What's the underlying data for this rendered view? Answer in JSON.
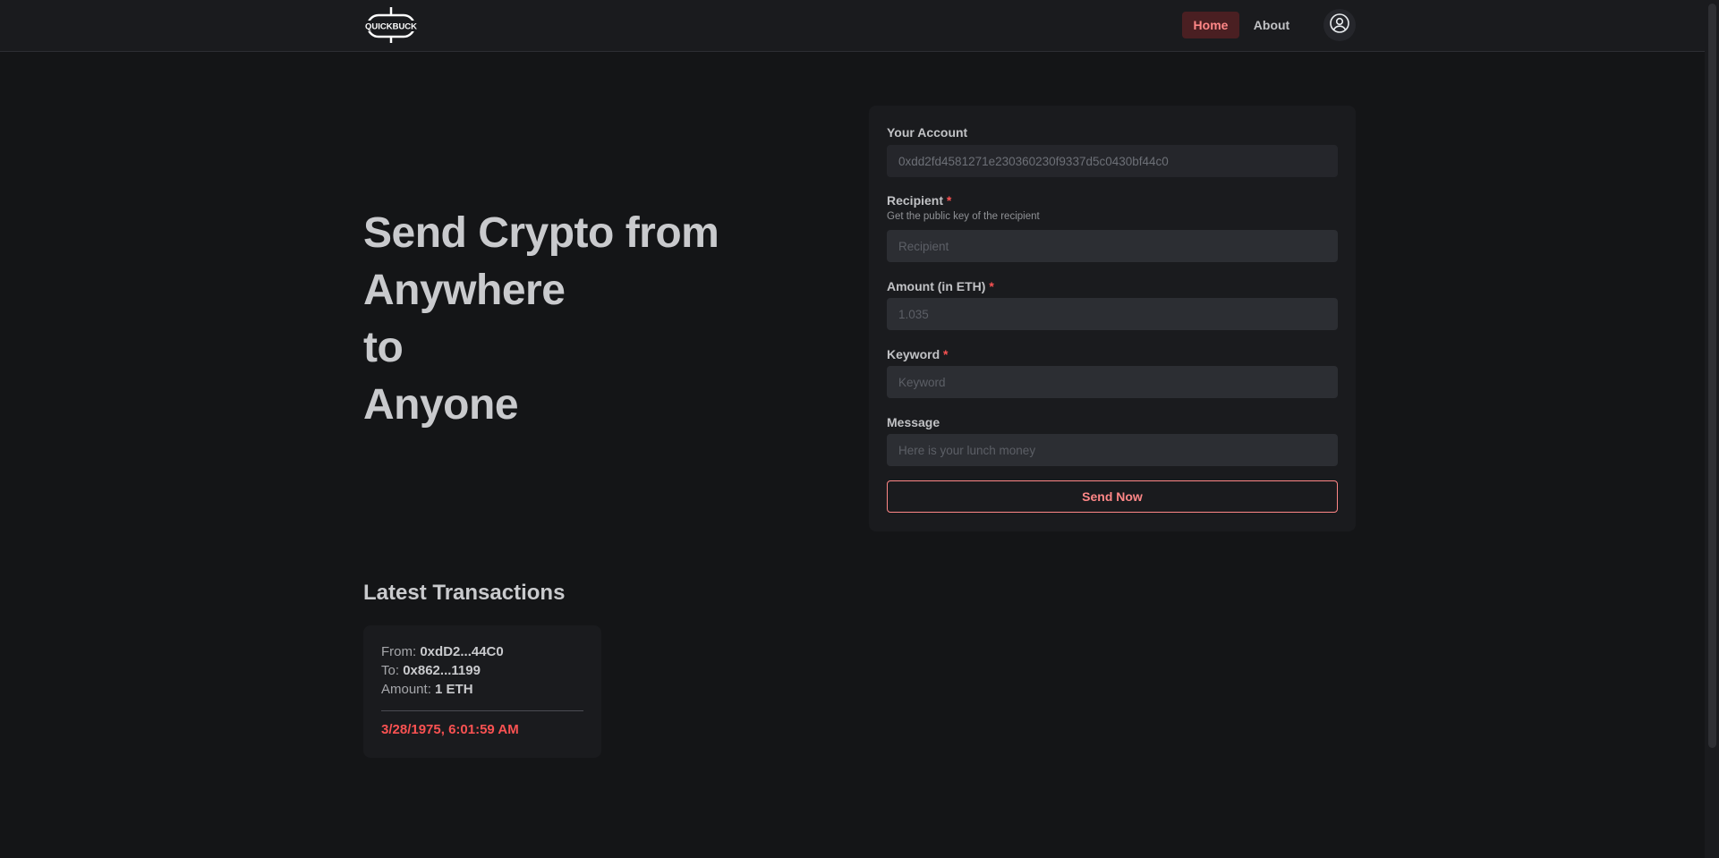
{
  "header": {
    "logo_text": "QUICKBUCK",
    "nav": {
      "home": "Home",
      "about": "About"
    }
  },
  "hero": {
    "lines": [
      "Send Crypto from",
      "Anywhere",
      "to",
      "Anyone"
    ]
  },
  "form": {
    "account": {
      "label": "Your Account",
      "value": "0xdd2fd4581271e230360230f9337d5c0430bf44c0"
    },
    "recipient": {
      "label": "Recipient",
      "required_mark": "*",
      "description": "Get the public key of the recipient",
      "placeholder": "Recipient"
    },
    "amount": {
      "label": "Amount (in ETH)",
      "required_mark": "*",
      "placeholder": "1.035"
    },
    "keyword": {
      "label": "Keyword",
      "required_mark": "*",
      "placeholder": "Keyword"
    },
    "message": {
      "label": "Message",
      "placeholder": "Here is your lunch money"
    },
    "send_label": "Send Now"
  },
  "transactions": {
    "title": "Latest Transactions",
    "items": [
      {
        "from_label": "From:",
        "from": "0xdD2...44C0",
        "to_label": "To:",
        "to": "0x862...1199",
        "amount_label": "Amount:",
        "amount": "1 ETH",
        "timestamp": "3/28/1975, 6:01:59 AM"
      }
    ]
  },
  "colors": {
    "background": "#141517",
    "card": "#1a1b1e",
    "accent": "#ff8787",
    "accent_strong": "#fa5252",
    "nav_active_bg": "#4a1f22"
  },
  "icons": {
    "logo": "quickbuck-logo",
    "user": "user-circle-icon"
  }
}
